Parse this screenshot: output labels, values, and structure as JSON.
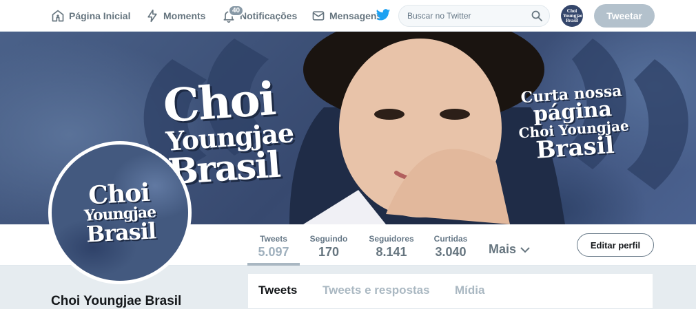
{
  "nav": {
    "home": "Página Inicial",
    "moments": "Moments",
    "notifications": "Notificações",
    "notifications_badge": "40",
    "messages": "Mensagens",
    "search_placeholder": "Buscar no Twitter",
    "tweet_button": "Tweetar",
    "avatar_text": "Choi Youngjae Brasil"
  },
  "banner": {
    "title_line1": "Choi",
    "title_line2": "Youngjae",
    "title_line3": "Brasil",
    "promo_line1": "Curta nossa",
    "promo_line2": "página",
    "promo_line3": "Choi Youngjae",
    "promo_line4": "Brasil"
  },
  "stats": [
    {
      "label": "Tweets",
      "value": "5.097"
    },
    {
      "label": "Seguindo",
      "value": "170"
    },
    {
      "label": "Seguidores",
      "value": "8.141"
    },
    {
      "label": "Curtidas",
      "value": "3.040"
    }
  ],
  "more_label": "Mais",
  "edit_profile": "Editar perfil",
  "avatar": {
    "line1": "Choi",
    "line2": "Youngjae",
    "line3": "Brasil"
  },
  "profile_name": "Choi Youngjae Brasil",
  "timeline_tabs": [
    "Tweets",
    "Tweets e respostas",
    "Mídia"
  ],
  "colors": {
    "accent": "#1da1f2",
    "tweet_button_disabled": "#b3c1cc",
    "banner_blue": "#3d537a"
  }
}
